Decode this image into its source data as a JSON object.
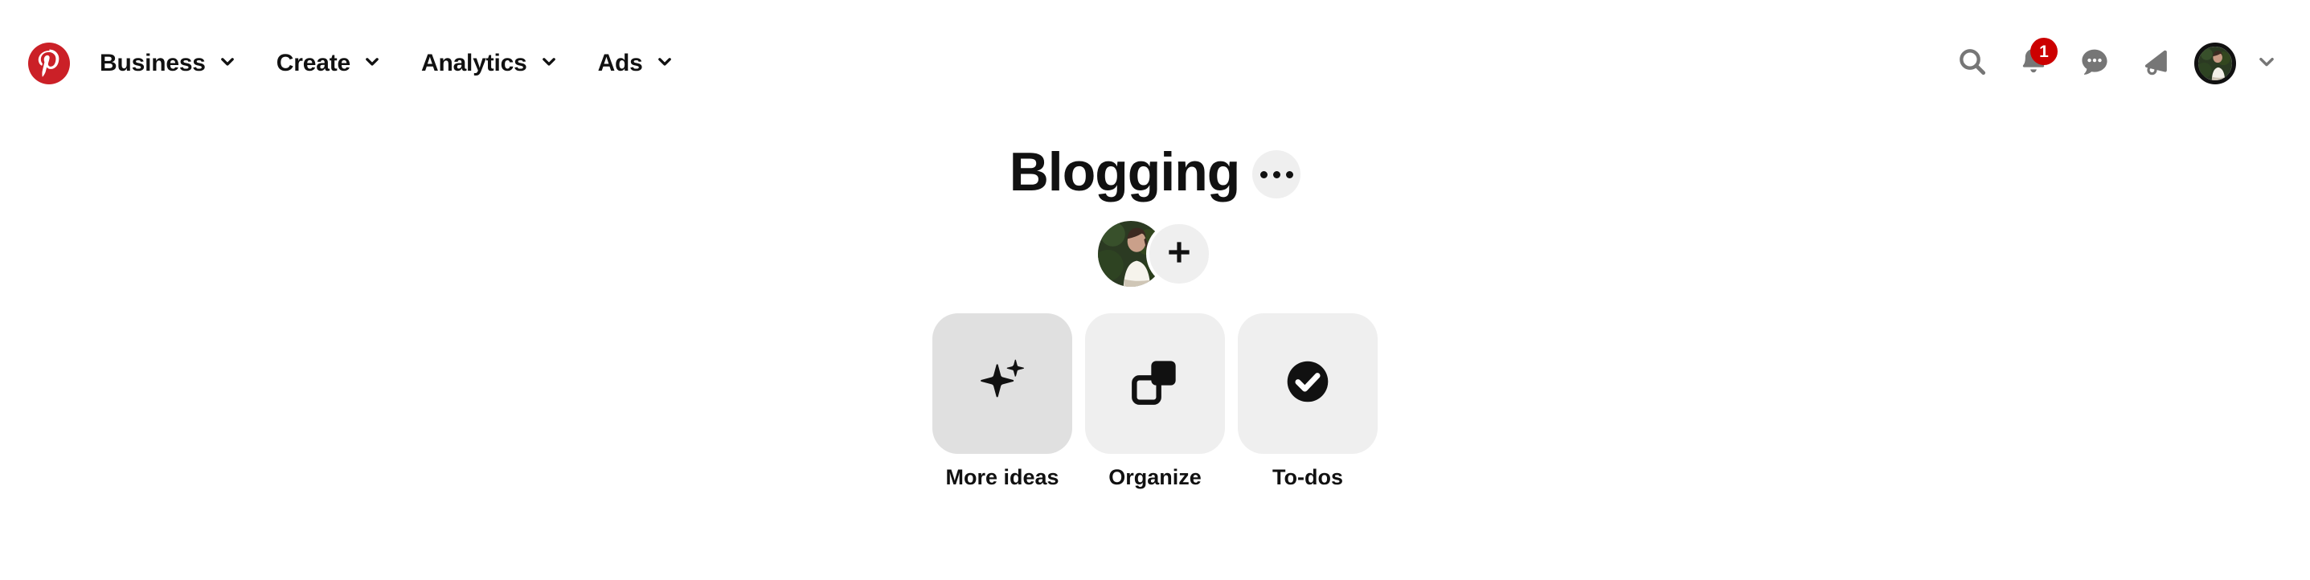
{
  "header": {
    "logo": {
      "icon": "pinterest-logo-icon",
      "color": "#cb2027"
    },
    "nav_items": [
      {
        "label": "Business",
        "icon": "chevron-down-icon"
      },
      {
        "label": "Create",
        "icon": "chevron-down-icon"
      },
      {
        "label": "Analytics",
        "icon": "chevron-down-icon"
      },
      {
        "label": "Ads",
        "icon": "chevron-down-icon"
      }
    ],
    "actions": {
      "search": {
        "icon": "search-icon"
      },
      "notifications": {
        "icon": "bell-icon",
        "badge_count": "1",
        "badge_color": "#cc0000"
      },
      "messages": {
        "icon": "speech-bubble-icon"
      },
      "announcements": {
        "icon": "megaphone-icon"
      },
      "account": {
        "icon": "avatar-icon"
      },
      "account_menu": {
        "icon": "chevron-down-icon"
      }
    },
    "icon_color": "#767676"
  },
  "board": {
    "title": "Blogging",
    "more_options": {
      "icon": "ellipsis-icon"
    },
    "collaborator": {
      "icon": "avatar-icon"
    },
    "add_collaborator": {
      "icon": "plus-icon"
    },
    "cards": [
      {
        "label": "More ideas",
        "icon": "sparkle-icon",
        "hovered": true
      },
      {
        "label": "Organize",
        "icon": "overlapping-squares-icon",
        "hovered": false
      },
      {
        "label": "To-dos",
        "icon": "check-circle-icon",
        "hovered": false
      }
    ]
  }
}
